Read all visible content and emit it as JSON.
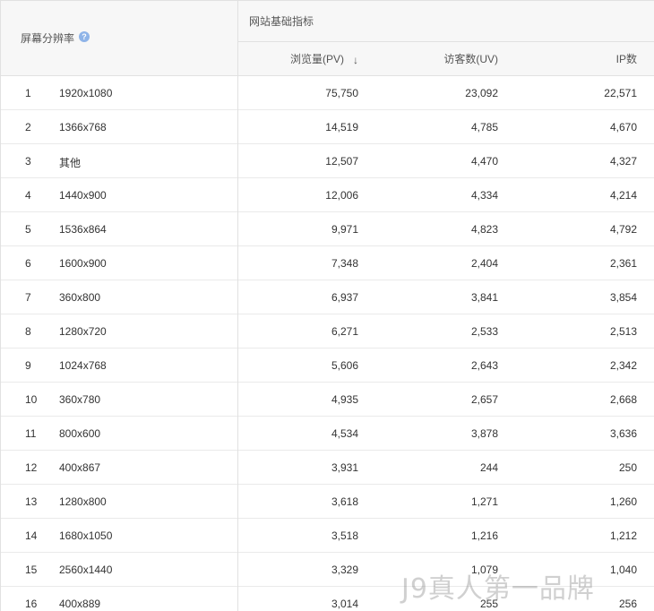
{
  "header": {
    "resolution_label": "屏幕分辨率",
    "help_icon": "?",
    "group_label": "网站基础指标",
    "pv_label": "浏览量(PV)",
    "sort_icon": "↓",
    "uv_label": "访客数(UV)",
    "ip_label": "IP数"
  },
  "rows": [
    {
      "rank": "1",
      "resolution": "1920x1080",
      "pv": "75,750",
      "uv": "23,092",
      "ip": "22,571"
    },
    {
      "rank": "2",
      "resolution": "1366x768",
      "pv": "14,519",
      "uv": "4,785",
      "ip": "4,670"
    },
    {
      "rank": "3",
      "resolution": "其他",
      "pv": "12,507",
      "uv": "4,470",
      "ip": "4,327"
    },
    {
      "rank": "4",
      "resolution": "1440x900",
      "pv": "12,006",
      "uv": "4,334",
      "ip": "4,214"
    },
    {
      "rank": "5",
      "resolution": "1536x864",
      "pv": "9,971",
      "uv": "4,823",
      "ip": "4,792"
    },
    {
      "rank": "6",
      "resolution": "1600x900",
      "pv": "7,348",
      "uv": "2,404",
      "ip": "2,361"
    },
    {
      "rank": "7",
      "resolution": "360x800",
      "pv": "6,937",
      "uv": "3,841",
      "ip": "3,854"
    },
    {
      "rank": "8",
      "resolution": "1280x720",
      "pv": "6,271",
      "uv": "2,533",
      "ip": "2,513"
    },
    {
      "rank": "9",
      "resolution": "1024x768",
      "pv": "5,606",
      "uv": "2,643",
      "ip": "2,342"
    },
    {
      "rank": "10",
      "resolution": "360x780",
      "pv": "4,935",
      "uv": "2,657",
      "ip": "2,668"
    },
    {
      "rank": "11",
      "resolution": "800x600",
      "pv": "4,534",
      "uv": "3,878",
      "ip": "3,636"
    },
    {
      "rank": "12",
      "resolution": "400x867",
      "pv": "3,931",
      "uv": "244",
      "ip": "250"
    },
    {
      "rank": "13",
      "resolution": "1280x800",
      "pv": "3,618",
      "uv": "1,271",
      "ip": "1,260"
    },
    {
      "rank": "14",
      "resolution": "1680x1050",
      "pv": "3,518",
      "uv": "1,216",
      "ip": "1,212"
    },
    {
      "rank": "15",
      "resolution": "2560x1440",
      "pv": "3,329",
      "uv": "1,079",
      "ip": "1,040"
    },
    {
      "rank": "16",
      "resolution": "400x889",
      "pv": "3,014",
      "uv": "255",
      "ip": "256"
    }
  ],
  "watermark": "J9真人第一品牌"
}
